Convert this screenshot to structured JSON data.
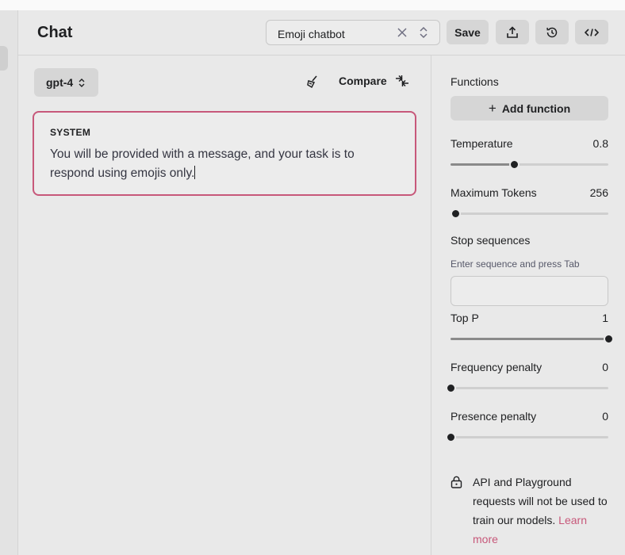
{
  "header": {
    "title": "Chat",
    "preset_value": "Emoji chatbot",
    "save_label": "Save"
  },
  "chat": {
    "model": "gpt-4",
    "compare_label": "Compare",
    "system_label": "SYSTEM",
    "system_text": "You will be provided with a message, and your task is to respond using emojis only."
  },
  "settings": {
    "functions_label": "Functions",
    "add_function_label": "Add function",
    "temperature": {
      "label": "Temperature",
      "value": "0.8",
      "fraction": 0.4
    },
    "max_tokens": {
      "label": "Maximum Tokens",
      "value": "256",
      "fraction": 0.03
    },
    "stop_sequences": {
      "label": "Stop sequences",
      "hint": "Enter sequence and press Tab",
      "value": ""
    },
    "top_p": {
      "label": "Top P",
      "value": "1",
      "fraction": 1.0
    },
    "frequency_penalty": {
      "label": "Frequency penalty",
      "value": "0",
      "fraction": 0.0
    },
    "presence_penalty": {
      "label": "Presence penalty",
      "value": "0",
      "fraction": 0.0
    },
    "notice_text": "API and Playground requests will not be used to train our models.",
    "notice_link": "Learn more"
  },
  "colors": {
    "accent": "#c7587a",
    "thumb": "#202123"
  }
}
